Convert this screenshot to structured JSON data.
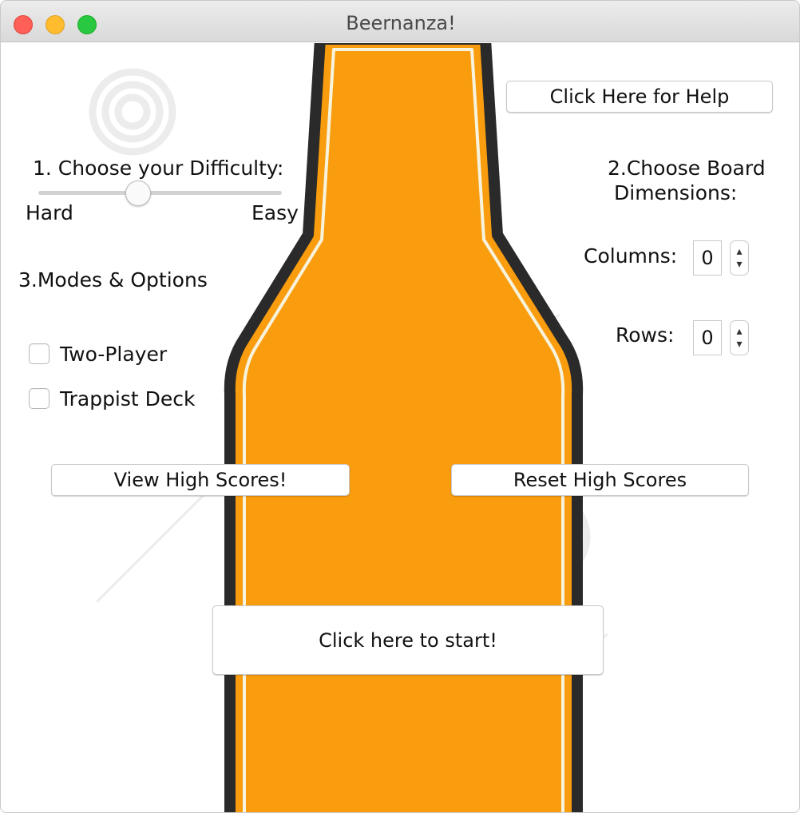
{
  "window": {
    "title": "Beernanza!"
  },
  "help_button": "Click Here for Help",
  "difficulty": {
    "heading": "1. Choose your Difficulty:",
    "min_label": "Hard",
    "max_label": "Easy",
    "value": 0.41
  },
  "board": {
    "heading_line1": "2.Choose Board",
    "heading_line2": "Dimensions:",
    "columns_label": "Columns:",
    "columns_value": "0",
    "rows_label": "Rows:",
    "rows_value": "0"
  },
  "modes": {
    "heading": "3.Modes & Options",
    "options": [
      {
        "label": "Two-Player",
        "checked": false
      },
      {
        "label": "Trappist Deck",
        "checked": false
      }
    ]
  },
  "view_scores_button": "View High Scores!",
  "reset_scores_button": "Reset High Scores",
  "start_button": "Click here to start!",
  "colors": {
    "bottle_fill": "#f99c0e",
    "bottle_outline": "#2a2a2a",
    "watermark": "#efefef"
  },
  "icons": {
    "spin_up": "▴",
    "spin_down": "▾"
  }
}
